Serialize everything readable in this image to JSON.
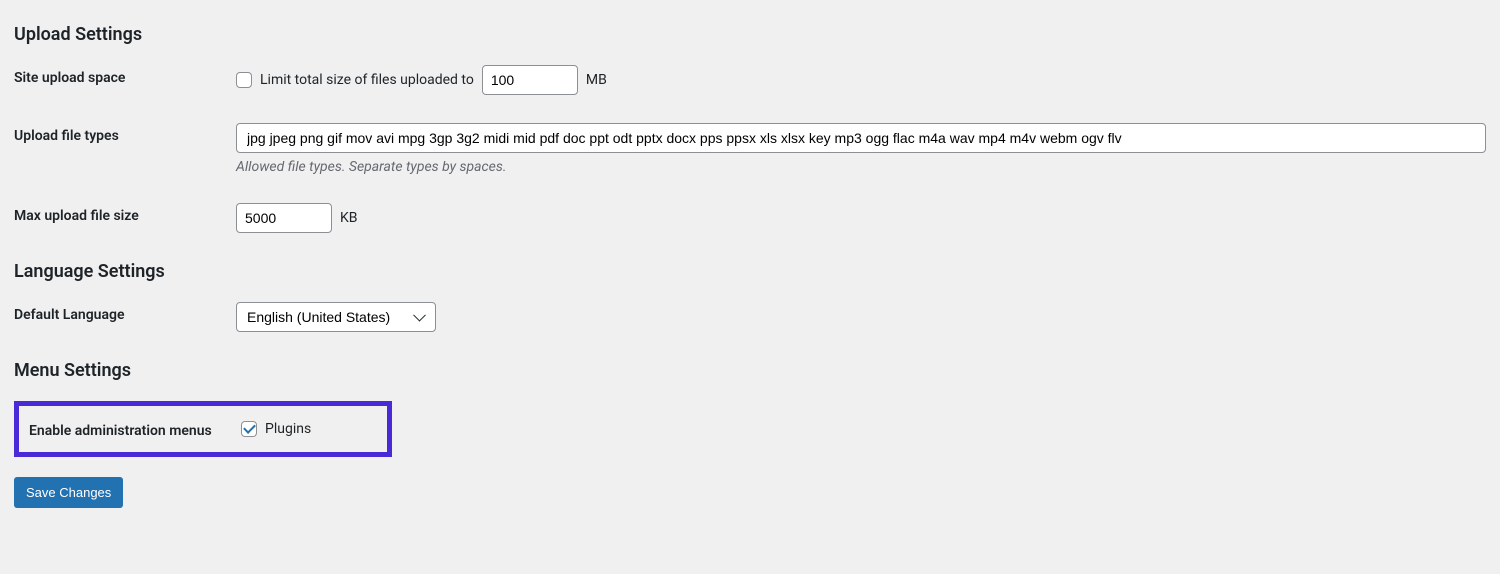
{
  "upload": {
    "heading": "Upload Settings",
    "site_space_label": "Site upload space",
    "limit_total_label": "Limit total size of files uploaded to",
    "limit_total_value": "100",
    "limit_total_unit": "MB",
    "file_types_label": "Upload file types",
    "file_types_value": "jpg jpeg png gif mov avi mpg 3gp 3g2 midi mid pdf doc ppt odt pptx docx pps ppsx xls xlsx key mp3 ogg flac m4a wav mp4 m4v webm ogv flv",
    "file_types_help": "Allowed file types. Separate types by spaces.",
    "max_size_label": "Max upload file size",
    "max_size_value": "5000",
    "max_size_unit": "KB"
  },
  "language": {
    "heading": "Language Settings",
    "default_label": "Default Language",
    "default_value": "English (United States)"
  },
  "menu": {
    "heading": "Menu Settings",
    "enable_admin_label": "Enable administration menus",
    "plugins_label": "Plugins"
  },
  "actions": {
    "save": "Save Changes"
  }
}
